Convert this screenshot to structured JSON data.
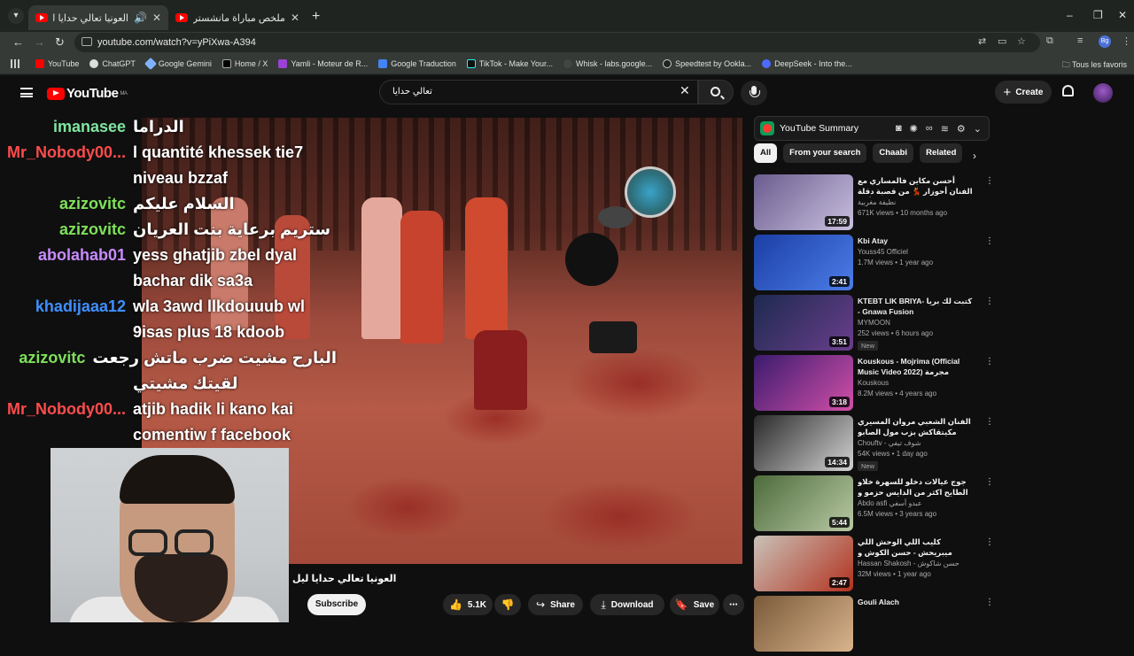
{
  "browser": {
    "tabs": [
      {
        "title": "العونيا تعالي حدايا ليل طويل",
        "active": true
      },
      {
        "title": "ملخص مباراة مانشستر يونايتد و"
      }
    ],
    "url": "youtube.com/watch?v=yPiXwa-A394",
    "bookmarks": [
      "YouTube",
      "ChatGPT",
      "Google Gemini",
      "Home / X",
      "Yamli - Moteur de R...",
      "Google Traduction",
      "TikTok - Make Your...",
      "Whisk - labs.google...",
      "Speedtest by Ookla...",
      "DeepSeek - Into the..."
    ],
    "bookmarks_right": "Tous les favoris",
    "profile_initials": "Bg"
  },
  "youtube": {
    "logo": "YouTube",
    "country": "MA",
    "search_query": "تعالي حدايا",
    "create_label": "Create"
  },
  "chat": [
    {
      "user": "imanasee",
      "color": "#7fe5a0",
      "msg": "الدراما"
    },
    {
      "user": "Mr_Nobody00...",
      "color": "#ff4b4b",
      "msg": "l quantité khessek tie7"
    },
    {
      "user": "",
      "color": "#ffffff",
      "msg": "niveau bzzaf"
    },
    {
      "user": "azizovitc",
      "color": "#7ee05a",
      "msg": "السلام عليكم"
    },
    {
      "user": "azizovitc",
      "color": "#7ee05a",
      "msg": "ستريم برعاية بنت العريان"
    },
    {
      "user": "abolahab01",
      "color": "#c88bff",
      "msg": "yess ghatjib zbel dyal"
    },
    {
      "user": "",
      "color": "#ffffff",
      "msg": "bachar dik sa3a"
    },
    {
      "user": "khadijaaa12",
      "color": "#3f8fff",
      "msg": "wla 3awd llkdouuub wl"
    },
    {
      "user": "",
      "color": "#ffffff",
      "msg": "9isas plus 18 kdoob"
    },
    {
      "user": "azizovitc",
      "color": "#7ee05a",
      "msg": "البارح مشيت ضرب ماتش رجعت"
    },
    {
      "user": "",
      "color": "#ffffff",
      "msg": "لقيتك مشيتي"
    },
    {
      "user": "Mr_Nobody00...",
      "color": "#ff4b4b",
      "msg": "atjib hadik li kano kai"
    },
    {
      "user": "",
      "color": "#ffffff",
      "msg": "comentiw f facebook"
    }
  ],
  "video": {
    "title": "العونيا تعالي حدايا ليل",
    "subscribe_label": "Subscribe",
    "likes": "5.1K",
    "share_label": "Share",
    "download_label": "Download",
    "save_label": "Save"
  },
  "summary": {
    "title": "YouTube Summary"
  },
  "chips": [
    "All",
    "From your search",
    "Chaabi",
    "Related"
  ],
  "recommendations": [
    {
      "title": "أحسن مكاين فالمساري مع الفنان أحوزار 💃 من قصبة دقلة فرجة معتمة مع أحلا",
      "channel": "نطيفة مغربية",
      "meta": "671K views • 10 months ago",
      "duration": "17:59",
      "colors": [
        "#6a5c8f",
        "#c9c0de"
      ],
      "new": ""
    },
    {
      "title": "Kbi Atay",
      "channel": "Youss45 Officiel",
      "meta": "1.7M views • 1 year ago",
      "duration": "2:41",
      "colors": [
        "#1b3fa5",
        "#4c7de8"
      ],
      "new": ""
    },
    {
      "title": "KTEBT LIK BRIYA- كتبت لك بريا - Gnawa Fusion",
      "channel": "MYMOON",
      "meta": "252 views • 6 hours ago",
      "duration": "3:51",
      "colors": [
        "#1d2a4f",
        "#6a3e8c"
      ],
      "new": "New"
    },
    {
      "title": "Kouskous - Mojrima (Official Music Video 2022) مجرمة مهرجان",
      "channel": "Kouskous",
      "meta": "8.2M views • 4 years ago",
      "duration": "3:18",
      "colors": [
        "#3a1b6e",
        "#d24fa8"
      ],
      "new": ""
    },
    {
      "title": "الفنان الشعبي مروان المسيري مكيتقاكش بزب مول الصابو طيحو كاو وشاف الفشية",
      "channel": "Chouftv - شوف تيفي",
      "meta": "54K views • 1 day ago",
      "duration": "14:34",
      "colors": [
        "#2a2a2a",
        "#d3d3d3"
      ],
      "new": "New"
    },
    {
      "title": "جوج عيالات دخلو للسهرة خلاو الطايح اكثر من الدايس حزمو و دخلو يشطحو سهرة مع",
      "channel": "Abdo asfi عبدو أسفي",
      "meta": "6.5M views • 3 years ago",
      "duration": "5:44",
      "colors": [
        "#4d6b3a",
        "#b9c9a5"
      ],
      "new": ""
    },
    {
      "title": "كليب اللي الوحش اللي ميبريحش - حسن الكوش و حماده مجدي - توزيع اسلام سامو",
      "channel": "Hassan Shakosh - حسن شاكوش",
      "meta": "32M views • 1 year ago",
      "duration": "2:47",
      "colors": [
        "#c9c2b8",
        "#b2321f"
      ],
      "new": ""
    },
    {
      "title": "Gouli Alach",
      "channel": "",
      "meta": "",
      "duration": "",
      "colors": [
        "#7a5a3a",
        "#d9b48c"
      ],
      "new": ""
    }
  ]
}
